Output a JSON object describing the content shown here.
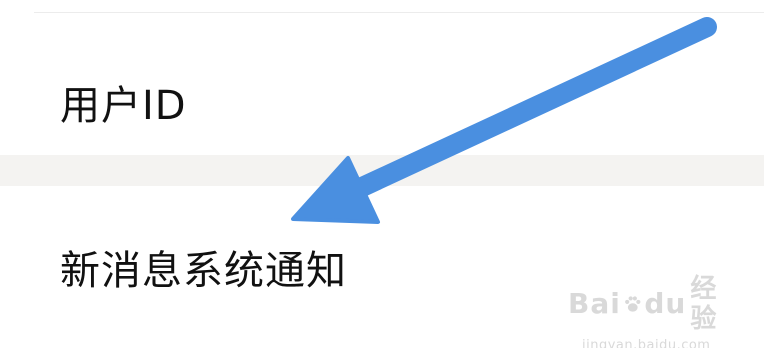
{
  "settings": {
    "items": [
      {
        "label": "用户ID"
      },
      {
        "label": "新消息系统通知"
      }
    ]
  },
  "annotation": {
    "arrow_color": "#4a8fe0"
  },
  "watermark": {
    "brand_left": "Bai",
    "brand_right": "du",
    "brand_cn": "经验",
    "url": "jingyan.baidu.com"
  }
}
